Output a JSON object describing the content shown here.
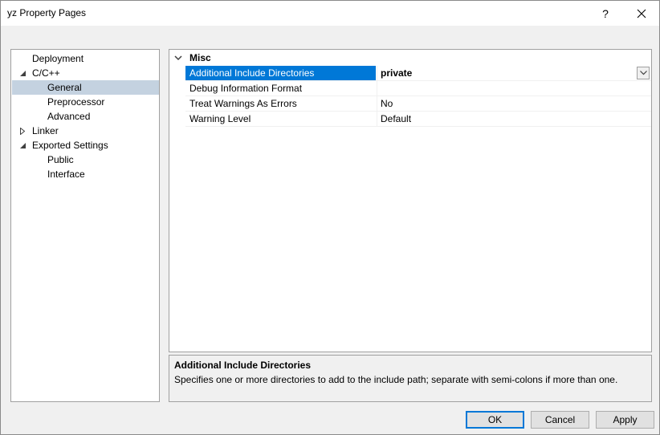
{
  "window": {
    "title": "yz Property Pages",
    "help_label": "?"
  },
  "tree": {
    "items": [
      {
        "label": "Deployment",
        "expander": "none",
        "indent": 0
      },
      {
        "label": "C/C++",
        "expander": "expanded",
        "indent": 0
      },
      {
        "label": "General",
        "expander": "none",
        "indent": 1,
        "selected": true
      },
      {
        "label": "Preprocessor",
        "expander": "none",
        "indent": 1
      },
      {
        "label": "Advanced",
        "expander": "none",
        "indent": 1
      },
      {
        "label": "Linker",
        "expander": "collapsed",
        "indent": 0
      },
      {
        "label": "Exported Settings",
        "expander": "expanded",
        "indent": 0
      },
      {
        "label": "Public",
        "expander": "none",
        "indent": 1
      },
      {
        "label": "Interface",
        "expander": "none",
        "indent": 1
      }
    ]
  },
  "grid": {
    "category": "Misc",
    "properties": [
      {
        "name": "Additional Include Directories",
        "value": "private",
        "selected": true
      },
      {
        "name": "Debug Information Format",
        "value": ""
      },
      {
        "name": "Treat Warnings As Errors",
        "value": "No"
      },
      {
        "name": "Warning Level",
        "value": "Default"
      }
    ]
  },
  "description": {
    "title": "Additional Include Directories",
    "text": "Specifies one or more directories to add to the include path; separate with semi-colons if more than one."
  },
  "buttons": {
    "ok": "OK",
    "cancel": "Cancel",
    "apply": "Apply"
  },
  "colors": {
    "selection": "#0078d7",
    "tree_selection": "#c4d2e0"
  }
}
